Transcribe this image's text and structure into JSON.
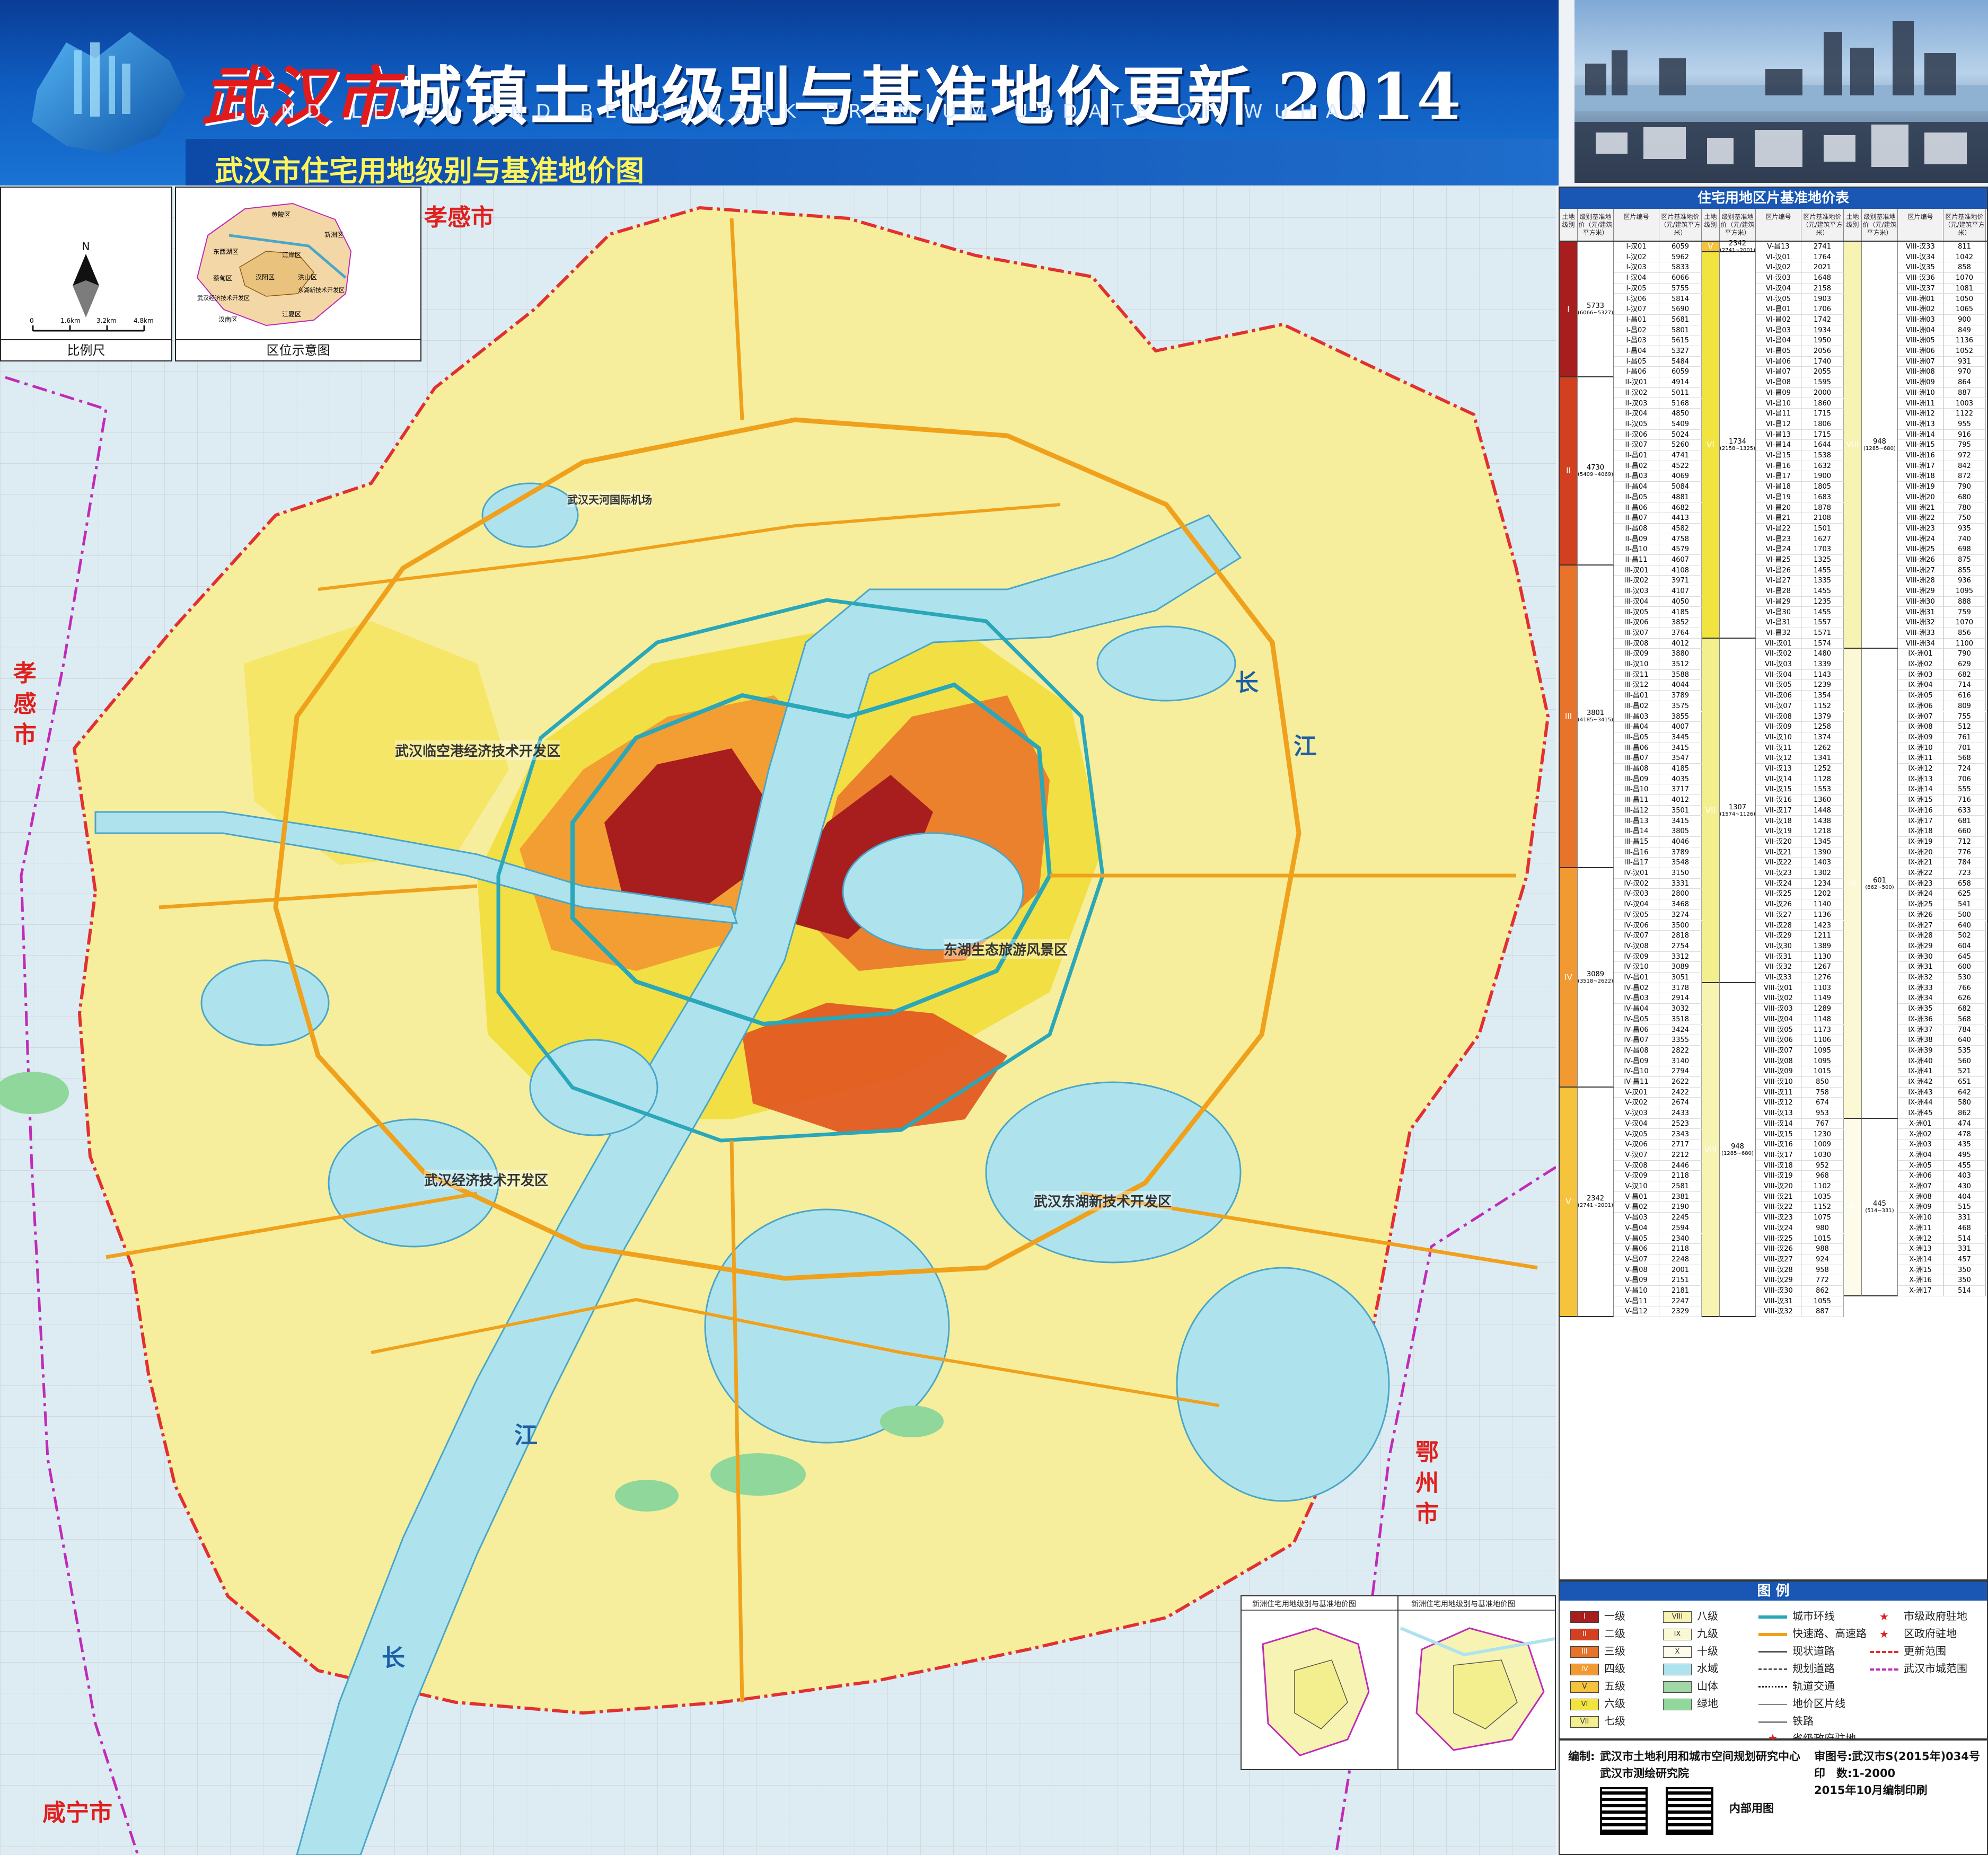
{
  "header": {
    "title_city": "武汉市",
    "title_rest": "城镇土地级别与基准地价更新",
    "title_year": "2014",
    "title_en": "LAND LEVEL AND BENCHMARK PREMIUM UPDATE OF WUHAN",
    "subtitle": "武汉市住宅用地级别与基准地价图"
  },
  "insets": {
    "scale_caption": "比例尺",
    "scale_ticks": [
      "0",
      "1.6km",
      "3.2km",
      "4.8km"
    ],
    "north": "N",
    "location_caption": "区位示意图",
    "location_districts": [
      "黄陂区",
      "新洲区",
      "东西湖区",
      "江岸区",
      "蔡甸区",
      "汉阳区",
      "洪山区",
      "东湖新技术开发区",
      "武汉经济技术开发区",
      "汉南区",
      "江夏区"
    ]
  },
  "map": {
    "city_labels": [
      "孝感市",
      "孝感市",
      "鄂州市",
      "咸宁市"
    ],
    "river_labels": [
      "长",
      "江",
      "长",
      "江"
    ],
    "zone_labels": [
      "武汉临空港经济技术开发区",
      "东湖生态旅游风景区",
      "武汉经济技术开发区",
      "武汉东湖新技术开发区",
      "武汉天河国际机场"
    ]
  },
  "table": {
    "title": "住宅用地区片基准地价表",
    "headers": [
      "土地级别",
      "级别基准地价（元/建筑平方米）",
      "区片编号",
      "区片基准地价（元/建筑平方米）"
    ],
    "levels": [
      {
        "level": "I",
        "price": "5733",
        "range": "(6066~5327)",
        "color": "#a81e1e"
      },
      {
        "level": "II",
        "price": "4730",
        "range": "(5409~4069)",
        "color": "#d3401f"
      },
      {
        "level": "III",
        "price": "3801",
        "range": "(4185~3415)",
        "color": "#e8732a"
      },
      {
        "level": "IV",
        "price": "3089",
        "range": "(3518~2622)",
        "color": "#f29a32"
      },
      {
        "level": "V",
        "price": "2342",
        "range": "(2741~2001)",
        "color": "#f6c33c"
      },
      {
        "level": "VI",
        "price": "1734",
        "range": "(2158~1325)",
        "color": "#f2e43e"
      },
      {
        "level": "VII",
        "price": "1307",
        "range": "(1574~1126)",
        "color": "#f4ef8e"
      },
      {
        "level": "VIII",
        "price": "948",
        "range": "(1285~680)",
        "color": "#f7f3b2"
      },
      {
        "level": "IX",
        "price": "601",
        "range": "(862~500)",
        "color": "#fbf8d4"
      },
      {
        "level": "X",
        "price": "445",
        "range": "(514~331)",
        "color": "#fdfcea"
      }
    ],
    "rows": [
      [
        "I-汉01",
        "6059"
      ],
      [
        "I-汉02",
        "5962"
      ],
      [
        "I-汉03",
        "5833"
      ],
      [
        "I-汉04",
        "6066"
      ],
      [
        "I-汉05",
        "5755"
      ],
      [
        "I-汉06",
        "5814"
      ],
      [
        "I-汉07",
        "5690"
      ],
      [
        "I-昌01",
        "5681"
      ],
      [
        "I-昌02",
        "5801"
      ],
      [
        "I-昌03",
        "5615"
      ],
      [
        "I-昌04",
        "5327"
      ],
      [
        "I-昌05",
        "5484"
      ],
      [
        "I-昌06",
        "6059"
      ],
      [
        "II-汉01",
        "4914"
      ],
      [
        "II-汉02",
        "5011"
      ],
      [
        "II-汉03",
        "5168"
      ],
      [
        "II-汉04",
        "4850"
      ],
      [
        "II-汉05",
        "5409"
      ],
      [
        "II-汉06",
        "5024"
      ],
      [
        "II-汉07",
        "5260"
      ],
      [
        "II-昌01",
        "4741"
      ],
      [
        "II-昌02",
        "4522"
      ],
      [
        "II-昌03",
        "4069"
      ],
      [
        "II-昌04",
        "5084"
      ],
      [
        "II-昌05",
        "4881"
      ],
      [
        "II-昌06",
        "4682"
      ],
      [
        "II-昌07",
        "4413"
      ],
      [
        "II-昌08",
        "4582"
      ],
      [
        "II-昌09",
        "4758"
      ],
      [
        "II-昌10",
        "4579"
      ],
      [
        "II-昌11",
        "4607"
      ],
      [
        "III-汉01",
        "4108"
      ],
      [
        "III-汉02",
        "3971"
      ],
      [
        "III-汉03",
        "4107"
      ],
      [
        "III-汉04",
        "4050"
      ],
      [
        "III-汉05",
        "4185"
      ],
      [
        "III-汉06",
        "3852"
      ],
      [
        "III-汉07",
        "3764"
      ],
      [
        "III-汉08",
        "4012"
      ],
      [
        "III-汉09",
        "3880"
      ],
      [
        "III-汉10",
        "3512"
      ],
      [
        "III-汉11",
        "3588"
      ],
      [
        "III-汉12",
        "4044"
      ],
      [
        "III-昌01",
        "3789"
      ],
      [
        "III-昌02",
        "3575"
      ],
      [
        "III-昌03",
        "3855"
      ],
      [
        "III-昌04",
        "4007"
      ],
      [
        "III-昌05",
        "3445"
      ],
      [
        "III-昌06",
        "3415"
      ],
      [
        "III-昌07",
        "3547"
      ],
      [
        "III-昌08",
        "4185"
      ],
      [
        "III-昌09",
        "4035"
      ],
      [
        "III-昌10",
        "3717"
      ],
      [
        "III-昌11",
        "4012"
      ],
      [
        "III-昌12",
        "3501"
      ],
      [
        "III-昌13",
        "3415"
      ],
      [
        "III-昌14",
        "3805"
      ],
      [
        "III-昌15",
        "4046"
      ],
      [
        "III-昌16",
        "3789"
      ],
      [
        "III-昌17",
        "3548"
      ],
      [
        "IV-汉01",
        "3150"
      ],
      [
        "IV-汉02",
        "3331"
      ],
      [
        "IV-汉03",
        "2800"
      ],
      [
        "IV-汉04",
        "3468"
      ],
      [
        "IV-汉05",
        "3274"
      ],
      [
        "IV-汉06",
        "3500"
      ],
      [
        "IV-汉07",
        "2818"
      ],
      [
        "IV-汉08",
        "2754"
      ],
      [
        "IV-汉09",
        "3312"
      ],
      [
        "IV-汉10",
        "3089"
      ],
      [
        "IV-昌01",
        "3051"
      ],
      [
        "IV-昌02",
        "3178"
      ],
      [
        "IV-昌03",
        "2914"
      ],
      [
        "IV-昌04",
        "3032"
      ],
      [
        "IV-昌05",
        "3518"
      ],
      [
        "IV-昌06",
        "3424"
      ],
      [
        "IV-昌07",
        "3355"
      ],
      [
        "IV-昌08",
        "2822"
      ],
      [
        "IV-昌09",
        "3140"
      ],
      [
        "IV-昌10",
        "2794"
      ],
      [
        "IV-昌11",
        "2622"
      ],
      [
        "V-汉01",
        "2422"
      ],
      [
        "V-汉02",
        "2674"
      ],
      [
        "V-汉03",
        "2433"
      ],
      [
        "V-汉04",
        "2523"
      ],
      [
        "V-汉05",
        "2343"
      ],
      [
        "V-汉06",
        "2717"
      ],
      [
        "V-汉07",
        "2212"
      ],
      [
        "V-汉08",
        "2446"
      ],
      [
        "V-汉09",
        "2118"
      ],
      [
        "V-汉10",
        "2581"
      ],
      [
        "V-昌01",
        "2381"
      ],
      [
        "V-昌02",
        "2190"
      ],
      [
        "V-昌03",
        "2245"
      ],
      [
        "V-昌04",
        "2594"
      ],
      [
        "V-昌05",
        "2340"
      ],
      [
        "V-昌06",
        "2118"
      ],
      [
        "V-昌07",
        "2248"
      ],
      [
        "V-昌08",
        "2001"
      ],
      [
        "V-昌09",
        "2151"
      ],
      [
        "V-昌10",
        "2181"
      ],
      [
        "V-昌11",
        "2247"
      ],
      [
        "V-昌12",
        "2329"
      ],
      [
        "V-昌13",
        "2741"
      ],
      [
        "VI-汉01",
        "1764"
      ],
      [
        "VI-汉02",
        "2021"
      ],
      [
        "VI-汉03",
        "1648"
      ],
      [
        "VI-汉04",
        "2158"
      ],
      [
        "VI-汉05",
        "1903"
      ],
      [
        "VI-昌01",
        "1706"
      ],
      [
        "VI-昌02",
        "1742"
      ],
      [
        "VI-昌03",
        "1934"
      ],
      [
        "VI-昌04",
        "1950"
      ],
      [
        "VI-昌05",
        "2056"
      ],
      [
        "VI-昌06",
        "1740"
      ],
      [
        "VI-昌07",
        "2055"
      ],
      [
        "VI-昌08",
        "1595"
      ],
      [
        "VI-昌09",
        "2000"
      ],
      [
        "VI-昌10",
        "1860"
      ],
      [
        "VI-昌11",
        "1715"
      ],
      [
        "VI-昌12",
        "1806"
      ],
      [
        "VI-昌13",
        "1715"
      ],
      [
        "VI-昌14",
        "1644"
      ],
      [
        "VI-昌15",
        "1538"
      ],
      [
        "VI-昌16",
        "1632"
      ],
      [
        "VI-昌17",
        "1900"
      ],
      [
        "VI-昌18",
        "1805"
      ],
      [
        "VI-昌19",
        "1683"
      ],
      [
        "VI-昌20",
        "1878"
      ],
      [
        "VI-昌21",
        "2108"
      ],
      [
        "VI-昌22",
        "1501"
      ],
      [
        "VI-昌23",
        "1627"
      ],
      [
        "VI-昌24",
        "1703"
      ],
      [
        "VI-昌25",
        "1325"
      ],
      [
        "VI-昌26",
        "1455"
      ],
      [
        "VI-昌27",
        "1335"
      ],
      [
        "VI-昌28",
        "1455"
      ],
      [
        "VI-昌29",
        "1235"
      ],
      [
        "VI-昌30",
        "1455"
      ],
      [
        "VI-昌31",
        "1557"
      ],
      [
        "VI-昌32",
        "1571"
      ],
      [
        "VII-汉01",
        "1574"
      ],
      [
        "VII-汉02",
        "1480"
      ],
      [
        "VII-汉03",
        "1339"
      ],
      [
        "VII-汉04",
        "1143"
      ],
      [
        "VII-汉05",
        "1239"
      ],
      [
        "VII-汉06",
        "1354"
      ],
      [
        "VII-汉07",
        "1152"
      ],
      [
        "VII-汉08",
        "1379"
      ],
      [
        "VII-汉09",
        "1258"
      ],
      [
        "VII-汉10",
        "1374"
      ],
      [
        "VII-汉11",
        "1262"
      ],
      [
        "VII-汉12",
        "1341"
      ],
      [
        "VII-汉13",
        "1252"
      ],
      [
        "VII-汉14",
        "1128"
      ],
      [
        "VII-汉15",
        "1553"
      ],
      [
        "VII-汉16",
        "1360"
      ],
      [
        "VII-汉17",
        "1448"
      ],
      [
        "VII-汉18",
        "1438"
      ],
      [
        "VII-汉19",
        "1218"
      ],
      [
        "VII-汉20",
        "1345"
      ],
      [
        "VII-汉21",
        "1390"
      ],
      [
        "VII-汉22",
        "1403"
      ],
      [
        "VII-汉23",
        "1302"
      ],
      [
        "VII-汉24",
        "1234"
      ],
      [
        "VII-汉25",
        "1202"
      ],
      [
        "VII-汉26",
        "1140"
      ],
      [
        "VII-汉27",
        "1136"
      ],
      [
        "VII-汉28",
        "1423"
      ],
      [
        "VII-汉29",
        "1211"
      ],
      [
        "VII-汉30",
        "1389"
      ],
      [
        "VII-汉31",
        "1130"
      ],
      [
        "VII-汉32",
        "1267"
      ],
      [
        "VII-汉33",
        "1276"
      ],
      [
        "VIII-汉01",
        "1103"
      ],
      [
        "VIII-汉02",
        "1149"
      ],
      [
        "VIII-汉03",
        "1289"
      ],
      [
        "VIII-汉04",
        "1148"
      ],
      [
        "VIII-汉05",
        "1173"
      ],
      [
        "VIII-汉06",
        "1106"
      ],
      [
        "VIII-汉07",
        "1095"
      ],
      [
        "VIII-汉08",
        "1095"
      ],
      [
        "VIII-汉09",
        "1015"
      ],
      [
        "VIII-汉10",
        "850"
      ],
      [
        "VIII-汉11",
        "758"
      ],
      [
        "VIII-汉12",
        "674"
      ],
      [
        "VIII-汉13",
        "953"
      ],
      [
        "VIII-汉14",
        "767"
      ],
      [
        "VIII-汉15",
        "1230"
      ],
      [
        "VIII-汉16",
        "1009"
      ],
      [
        "VIII-汉17",
        "1030"
      ],
      [
        "VIII-汉18",
        "952"
      ],
      [
        "VIII-汉19",
        "968"
      ],
      [
        "VIII-汉20",
        "1102"
      ],
      [
        "VIII-汉21",
        "1035"
      ],
      [
        "VIII-汉22",
        "1152"
      ],
      [
        "VIII-汉23",
        "1075"
      ],
      [
        "VIII-汉24",
        "980"
      ],
      [
        "VIII-汉25",
        "1015"
      ],
      [
        "VIII-汉26",
        "988"
      ],
      [
        "VIII-汉27",
        "924"
      ],
      [
        "VIII-汉28",
        "958"
      ],
      [
        "VIII-汉29",
        "772"
      ],
      [
        "VIII-汉30",
        "862"
      ],
      [
        "VIII-汉31",
        "1055"
      ],
      [
        "VIII-汉32",
        "887"
      ],
      [
        "VIII-汉33",
        "811"
      ],
      [
        "VIII-汉34",
        "1042"
      ],
      [
        "VIII-汉35",
        "858"
      ],
      [
        "VIII-汉36",
        "1070"
      ],
      [
        "VIII-汉37",
        "1081"
      ],
      [
        "VIII-洲01",
        "1050"
      ],
      [
        "VIII-洲02",
        "1065"
      ],
      [
        "VIII-洲03",
        "900"
      ],
      [
        "VIII-洲04",
        "849"
      ],
      [
        "VIII-洲05",
        "1136"
      ],
      [
        "VIII-洲06",
        "1052"
      ],
      [
        "VIII-洲07",
        "931"
      ],
      [
        "VIII-洲08",
        "970"
      ],
      [
        "VIII-洲09",
        "864"
      ],
      [
        "VIII-洲10",
        "887"
      ],
      [
        "VIII-洲11",
        "1003"
      ],
      [
        "VIII-洲12",
        "1122"
      ],
      [
        "VIII-洲13",
        "955"
      ],
      [
        "VIII-洲14",
        "916"
      ],
      [
        "VIII-洲15",
        "795"
      ],
      [
        "VIII-洲16",
        "972"
      ],
      [
        "VIII-洲17",
        "842"
      ],
      [
        "VIII-洲18",
        "872"
      ],
      [
        "VIII-洲19",
        "790"
      ],
      [
        "VIII-洲20",
        "680"
      ],
      [
        "VIII-洲21",
        "780"
      ],
      [
        "VIII-洲22",
        "750"
      ],
      [
        "VIII-洲23",
        "935"
      ],
      [
        "VIII-洲24",
        "740"
      ],
      [
        "VIII-洲25",
        "698"
      ],
      [
        "VIII-洲26",
        "875"
      ],
      [
        "VIII-洲27",
        "855"
      ],
      [
        "VIII-洲28",
        "936"
      ],
      [
        "VIII-洲29",
        "1095"
      ],
      [
        "VIII-洲30",
        "888"
      ],
      [
        "VIII-洲31",
        "759"
      ],
      [
        "VIII-洲32",
        "1070"
      ],
      [
        "VIII-洲33",
        "856"
      ],
      [
        "VIII-洲34",
        "1100"
      ],
      [
        "IX-洲01",
        "790"
      ],
      [
        "IX-洲02",
        "629"
      ],
      [
        "IX-洲03",
        "682"
      ],
      [
        "IX-洲04",
        "714"
      ],
      [
        "IX-洲05",
        "616"
      ],
      [
        "IX-洲06",
        "809"
      ],
      [
        "IX-洲07",
        "755"
      ],
      [
        "IX-洲08",
        "512"
      ],
      [
        "IX-洲09",
        "761"
      ],
      [
        "IX-洲10",
        "701"
      ],
      [
        "IX-洲11",
        "568"
      ],
      [
        "IX-洲12",
        "724"
      ],
      [
        "IX-洲13",
        "706"
      ],
      [
        "IX-洲14",
        "555"
      ],
      [
        "IX-洲15",
        "716"
      ],
      [
        "IX-洲16",
        "633"
      ],
      [
        "IX-洲17",
        "681"
      ],
      [
        "IX-洲18",
        "660"
      ],
      [
        "IX-洲19",
        "712"
      ],
      [
        "IX-洲20",
        "776"
      ],
      [
        "IX-洲21",
        "784"
      ],
      [
        "IX-洲22",
        "723"
      ],
      [
        "IX-洲23",
        "658"
      ],
      [
        "IX-洲24",
        "625"
      ],
      [
        "IX-洲25",
        "541"
      ],
      [
        "IX-洲26",
        "500"
      ],
      [
        "IX-洲27",
        "640"
      ],
      [
        "IX-洲28",
        "502"
      ],
      [
        "IX-洲29",
        "604"
      ],
      [
        "IX-洲30",
        "645"
      ],
      [
        "IX-洲31",
        "600"
      ],
      [
        "IX-洲32",
        "530"
      ],
      [
        "IX-洲33",
        "766"
      ],
      [
        "IX-洲34",
        "626"
      ],
      [
        "IX-洲35",
        "682"
      ],
      [
        "IX-洲36",
        "568"
      ],
      [
        "IX-洲37",
        "784"
      ],
      [
        "IX-洲38",
        "640"
      ],
      [
        "IX-洲39",
        "535"
      ],
      [
        "IX-洲40",
        "560"
      ],
      [
        "IX-洲41",
        "521"
      ],
      [
        "IX-洲42",
        "651"
      ],
      [
        "IX-洲43",
        "642"
      ],
      [
        "IX-洲44",
        "580"
      ],
      [
        "IX-洲45",
        "862"
      ],
      [
        "X-洲01",
        "474"
      ],
      [
        "X-洲02",
        "478"
      ],
      [
        "X-洲03",
        "435"
      ],
      [
        "X-洲04",
        "495"
      ],
      [
        "X-洲05",
        "455"
      ],
      [
        "X-洲06",
        "403"
      ],
      [
        "X-洲07",
        "430"
      ],
      [
        "X-洲08",
        "404"
      ],
      [
        "X-洲09",
        "515"
      ],
      [
        "X-洲10",
        "331"
      ],
      [
        "X-洲11",
        "468"
      ],
      [
        "X-洲12",
        "514"
      ],
      [
        "X-洲13",
        "331"
      ],
      [
        "X-洲14",
        "457"
      ],
      [
        "X-洲15",
        "350"
      ],
      [
        "X-洲16",
        "350"
      ],
      [
        "X-洲17",
        "514"
      ]
    ]
  },
  "legend": {
    "title": "图 例",
    "levels": [
      {
        "code": "I",
        "label": "一级",
        "color": "#a81e1e"
      },
      {
        "code": "II",
        "label": "二级",
        "color": "#d3401f"
      },
      {
        "code": "III",
        "label": "三级",
        "color": "#e8732a"
      },
      {
        "code": "IV",
        "label": "四级",
        "color": "#f29a32"
      },
      {
        "code": "V",
        "label": "五级",
        "color": "#f6c33c"
      },
      {
        "code": "VI",
        "label": "六级",
        "color": "#f2e43e"
      },
      {
        "code": "VII",
        "label": "七级",
        "color": "#f4ef8e"
      },
      {
        "code": "VIII",
        "label": "八级",
        "color": "#f7f3b2"
      },
      {
        "code": "IX",
        "label": "九级",
        "color": "#fbf8d4"
      },
      {
        "code": "X",
        "label": "十级",
        "color": "#fdfcea"
      }
    ],
    "features": [
      {
        "label": "水域",
        "color": "#aee3ee"
      },
      {
        "label": "山体",
        "color": "#9fd7a6"
      },
      {
        "label": "绿地",
        "color": "#8fd79a"
      }
    ],
    "lines": [
      "城市环线",
      "快速路、高速路",
      "现状道路",
      "规划道路",
      "轨道交通",
      "地价区片线",
      "铁路"
    ],
    "symbols": [
      "市级政府驻地",
      "区政府驻地",
      "更新范围",
      "武汉市城范围",
      "省级政府驻地"
    ]
  },
  "small_maps": {
    "left_title": "新洲住宅用地级别与基准地价图",
    "right_title": "新洲住宅用地级别与基准地价图"
  },
  "credits": {
    "compiler_label": "编制:",
    "compiler": "武汉市土地利用和城市空间规划研究中心",
    "compiler2": "武汉市测绘研究院",
    "review": "审图号:武汉市S(2015年)034号",
    "copies": "印　数:1-2000",
    "date": "2015年10月编制印刷",
    "internal": "内部用图"
  }
}
